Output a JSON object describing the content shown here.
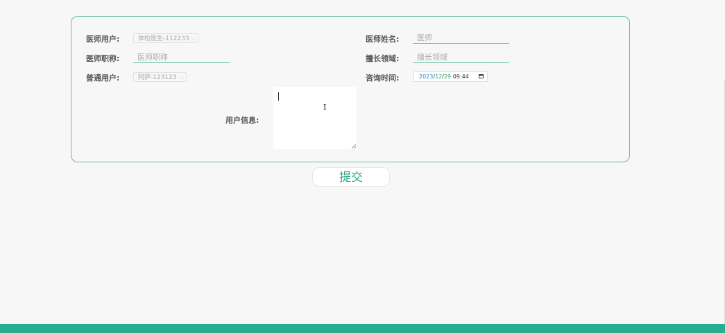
{
  "form": {
    "doctor_user": {
      "label": "医师用户:",
      "value": "体检医生-112233"
    },
    "doctor_name": {
      "label": "医师姓名:",
      "placeholder": "医师"
    },
    "doctor_title": {
      "label": "医师职称:",
      "placeholder": "医师职称"
    },
    "specialty": {
      "label": "擅长领域:",
      "placeholder": "擅长领域"
    },
    "normal_user": {
      "label": "普通用户:",
      "value": "阿萨-123123"
    },
    "consult_time": {
      "label": "咨询时间:",
      "year": "2023",
      "month": "12",
      "day": "29",
      "time": "09:44"
    },
    "user_info": {
      "label": "用户信息:"
    }
  },
  "actions": {
    "submit_label": "提交"
  },
  "colors": {
    "accent": "#5cbf9f",
    "footer": "#26ae93",
    "button_text": "#2aa88a"
  }
}
